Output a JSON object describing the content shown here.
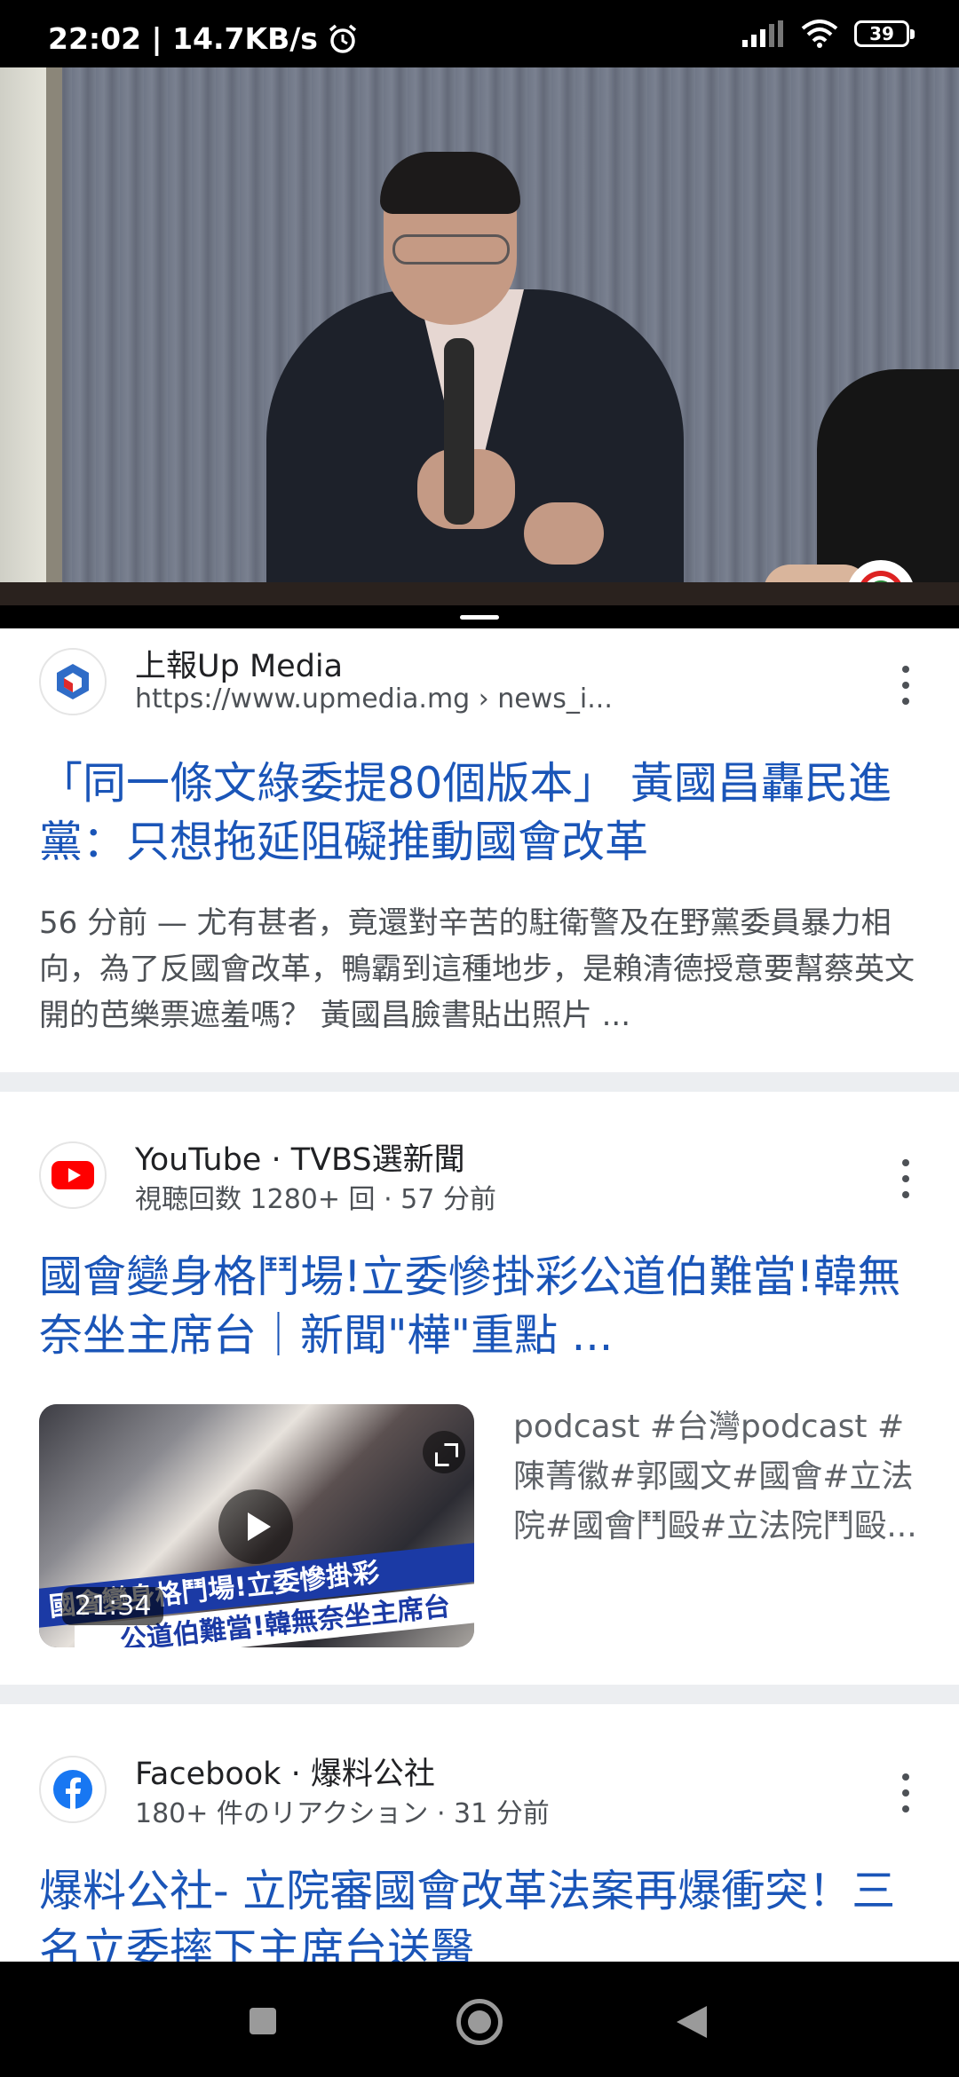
{
  "status_bar": {
    "time_speed": "22:02 | 14.7KB/s",
    "battery": "39"
  },
  "results": [
    {
      "source_name": "上報Up Media",
      "source_sub": "https://www.upmedia.mg › news_i...",
      "title": "「同一條文綠委提80個版本」 黃國昌轟民進黨：只想拖延阻礙推動國會改革",
      "snippet": "56 分前 — 尤有甚者，竟還對辛苦的駐衛警及在野黨委員暴力相向，為了反國會改革，鴨霸到這種地步，是賴清德授意要幫蔡英文開的芭樂票遮羞嗎？ 黃國昌臉書貼出照片 ..."
    },
    {
      "source_name": "YouTube · TVBS選新聞",
      "source_sub": "視聴回数 1280+ 回 · 57 分前",
      "title": "國會變身格鬥場!立委慘掛彩公道伯難當!韓無奈坐主席台｜新聞\"樺\"重點 ...",
      "thumbnail_text_1": "國會變身格鬥場!立委慘掛彩",
      "thumbnail_text_2": "公道伯難當!韓無奈坐主席台",
      "duration": "21:34",
      "description": "podcast #台灣podcast #陳菁徽#郭國文#國會#立法院#國會鬥毆#立法院鬥毆..."
    },
    {
      "source_name": "Facebook · 爆料公社",
      "source_sub": "180+ 件のリアクション · 31 分前",
      "title": "爆料公社- 立院審國會改革法案再爆衝突！三名立委摔下主席台送醫"
    }
  ],
  "colors": {
    "title_link": "#1a55b8",
    "snippet": "#4d5156",
    "divider": "#eceef1"
  }
}
